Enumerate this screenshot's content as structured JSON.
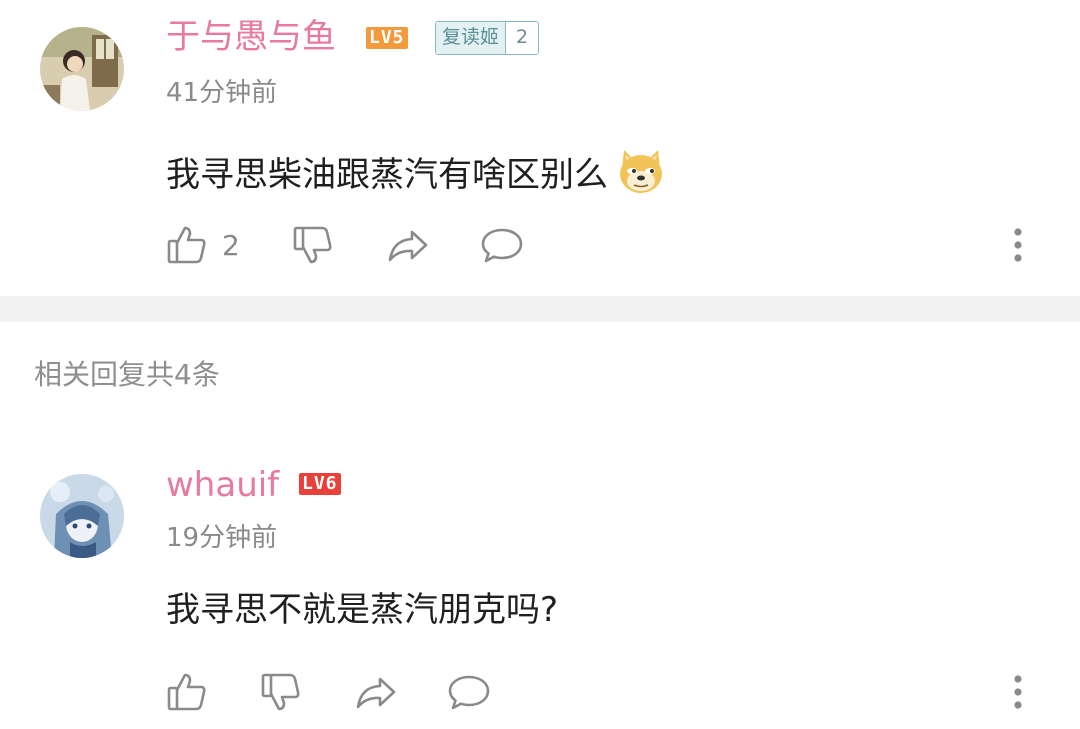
{
  "main_comment": {
    "username": "于与愚与鱼",
    "level": "LV5",
    "fan_badge": {
      "name": "复读姬",
      "level": "2"
    },
    "time": "41分钟前",
    "text": "我寻思柴油跟蒸汽有啥区别么",
    "emoji": "doge-emoji",
    "like_count": "2"
  },
  "replies_heading": "相关回复共4条",
  "reply_comment": {
    "username": "whauif",
    "level": "LV6",
    "time": "19分钟前",
    "text": "我寻思不就是蒸汽朋克吗?"
  },
  "colors": {
    "username": "#e87aa0",
    "lv5": "#f29a3c",
    "lv6": "#e8403b",
    "meta_text": "#8a8a8a",
    "icon": "#8a8a8a",
    "divider": "#f2f2f2"
  },
  "icons": [
    "thumbs-up-icon",
    "thumbs-down-icon",
    "share-icon",
    "reply-bubble-icon",
    "more-vertical-icon"
  ]
}
